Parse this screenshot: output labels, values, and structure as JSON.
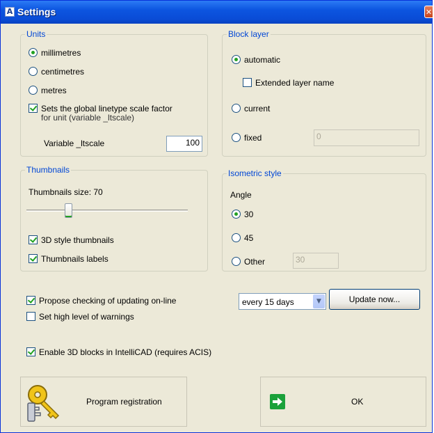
{
  "window": {
    "title": "Settings",
    "title_icon": "A",
    "close_glyph": "✕"
  },
  "units": {
    "legend": "Units",
    "options": [
      {
        "label": "millimetres",
        "selected": true
      },
      {
        "label": "centimetres",
        "selected": false
      },
      {
        "label": "metres",
        "selected": false
      }
    ],
    "ltscale_check": {
      "line1": "Sets the global linetype scale factor",
      "line2": "for unit (variable _ltscale)",
      "checked": true
    },
    "ltscale_label": "Variable _ltscale",
    "ltscale_value": "100"
  },
  "block_layer": {
    "legend": "Block layer",
    "automatic": {
      "label": "automatic",
      "selected": true
    },
    "extended": {
      "label": "Extended layer name",
      "checked": false
    },
    "current": {
      "label": "current",
      "selected": false
    },
    "fixed": {
      "label": "fixed",
      "selected": false
    },
    "fixed_value": "0"
  },
  "thumbnails": {
    "legend": "Thumbnails",
    "size_label": "Thumbnails size: 70",
    "size_level": 0.25,
    "style_3d": {
      "label": "3D style thumbnails",
      "checked": true
    },
    "labels": {
      "label": "Thumbnails labels",
      "checked": true
    }
  },
  "isometric": {
    "legend": "Isometric style",
    "angle_label": "Angle",
    "options": [
      {
        "label": "30",
        "selected": true
      },
      {
        "label": "45",
        "selected": false
      },
      {
        "label": "Other",
        "selected": false
      }
    ],
    "other_value": "30"
  },
  "updates": {
    "propose": {
      "label": "Propose checking of updating on-line",
      "checked": true
    },
    "warnings": {
      "label": "Set high level of warnings",
      "checked": false
    },
    "frequency": "every 15 days",
    "update_button": "Update now..."
  },
  "blocks_3d": {
    "label": "Enable 3D blocks in IntelliCAD (requires ACIS)",
    "checked": true
  },
  "registration_button": "Program registration",
  "ok_button": "OK",
  "icons": {
    "keys": "keys-icon",
    "ok_arrow": "green-arrow-icon"
  },
  "colors": {
    "accent_green": "#21a121",
    "group_label": "#0046d5",
    "title_bar": "#0a4cd6"
  }
}
